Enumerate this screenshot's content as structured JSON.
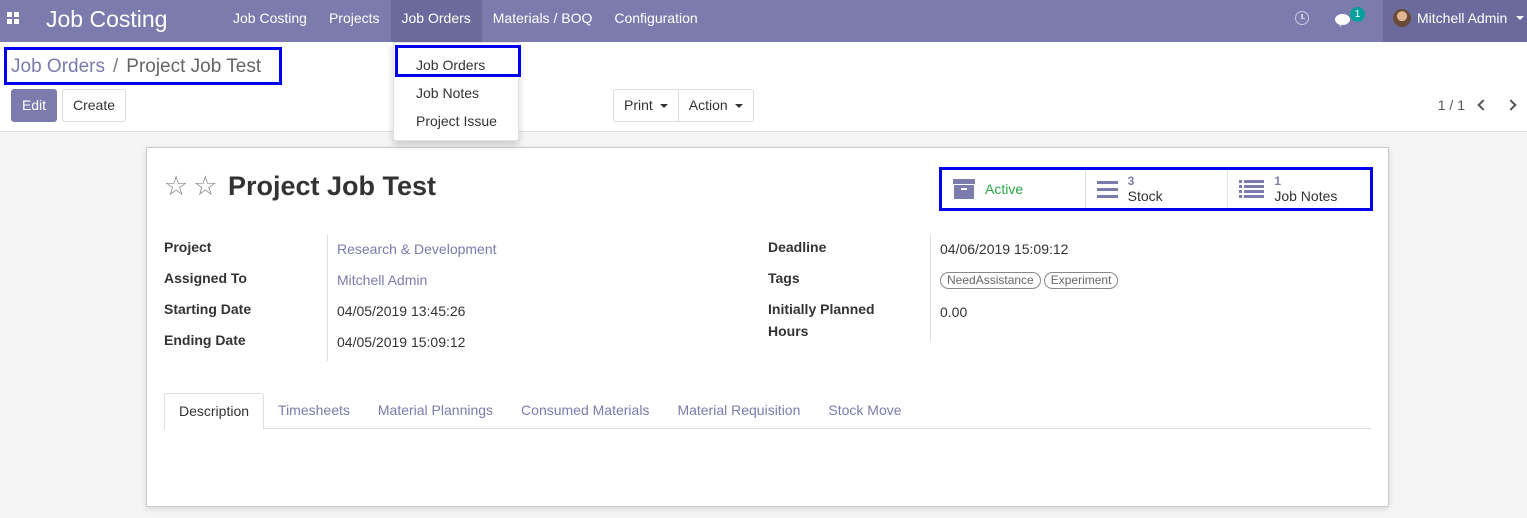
{
  "navbar": {
    "app_title": "Job Costing",
    "menu": [
      "Job Costing",
      "Projects",
      "Job Orders",
      "Materials / BOQ",
      "Configuration"
    ],
    "active_menu": "Job Orders",
    "chat_count": "1",
    "user_name": "Mitchell Admin",
    "color": "#7c7bad"
  },
  "dropdown": {
    "items": [
      "Job Orders",
      "Job Notes",
      "Project Issue"
    ]
  },
  "breadcrumb": {
    "parent": "Job Orders",
    "separator": "/",
    "current": "Project Job Test"
  },
  "buttons": {
    "edit": "Edit",
    "create": "Create",
    "print": "Print",
    "action": "Action"
  },
  "pager": {
    "value": "1 / 1"
  },
  "record": {
    "title": "Project Job Test",
    "smart_buttons": {
      "active_label": "Active",
      "stock_count": "3",
      "stock_label": "Stock",
      "notes_count": "1",
      "notes_label": "Job Notes"
    },
    "fields_left": [
      {
        "label": "Project",
        "value": "Research & Development"
      },
      {
        "label": "Assigned To",
        "value": "Mitchell Admin"
      },
      {
        "label": "Starting Date",
        "value": "04/05/2019 13:45:26"
      },
      {
        "label": "Ending Date",
        "value": "04/05/2019 15:09:12"
      }
    ],
    "fields_right": {
      "deadline_label": "Deadline",
      "deadline_value": "04/06/2019 15:09:12",
      "tags_label": "Tags",
      "tags": [
        "NeedAssistance",
        "Experiment"
      ],
      "hours_label_1": "Initially Planned",
      "hours_label_2": "Hours",
      "hours_value": "0.00"
    }
  },
  "tabs": [
    "Description",
    "Timesheets",
    "Material Plannings",
    "Consumed Materials",
    "Material Requisition",
    "Stock Move"
  ],
  "active_tab": "Description"
}
